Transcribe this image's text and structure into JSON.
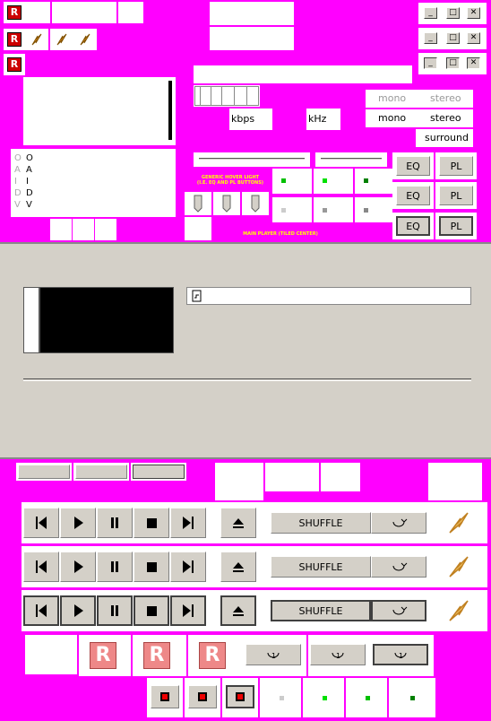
{
  "top_logos": {
    "logo_text": "R"
  },
  "title_buttons": {
    "minimize": "_",
    "maximize": "□",
    "close": "✕"
  },
  "vis_channels": [
    "O",
    "A",
    "I",
    "D",
    "V"
  ],
  "vis_channels_dim": [
    "O",
    "A",
    "I",
    "D",
    "V"
  ],
  "info": {
    "kbps": "kbps",
    "khz": "kHz"
  },
  "mono_stereo": {
    "row1": {
      "mono": "mono",
      "stereo": "stereo"
    },
    "row2": {
      "mono": "mono",
      "stereo": "stereo"
    },
    "surround": "surround"
  },
  "toggles": {
    "eq": "EQ",
    "pl": "PL"
  },
  "notes": {
    "hover_light": "GENERIC HOVER LIGHT\n(I.E. EQ AND PL BUTTONS)",
    "main_player": "MAIN PLAYER (TILED CENTER)"
  },
  "transport": {
    "shuffle": "SHUFFLE"
  },
  "colors": {
    "magenta": "#ff00ff",
    "face": "#d4d0c8",
    "green": "#00c000",
    "red": "#e00000",
    "note": "#ffff00"
  }
}
